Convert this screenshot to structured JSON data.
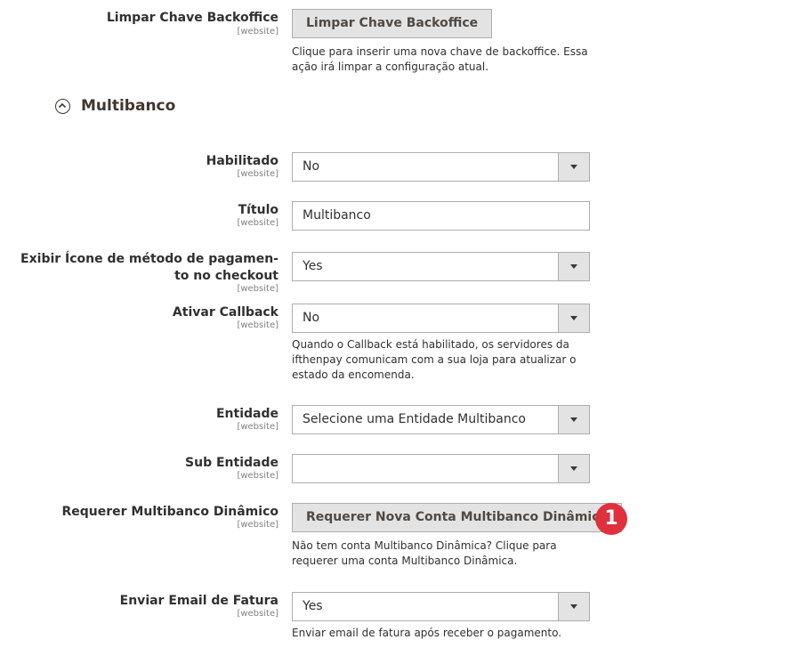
{
  "fields": {
    "limpar": {
      "label": "Limpar Chave Backoffice",
      "scope": "[website]",
      "button": "Limpar Chave Backoffice",
      "note": "Clique para inserir uma nova chave de backoffice. Essa ação irá limpar a configuração atual."
    },
    "section": {
      "title": "Multibanco"
    },
    "habilitado": {
      "label": "Habilitado",
      "scope": "[website]",
      "value": "No"
    },
    "titulo": {
      "label": "Título",
      "scope": "[website]",
      "value": "Multibanco"
    },
    "exibir_icone": {
      "label_line1": "Exibir Ícone de método de pagamen-",
      "label_line2": "to no checkout",
      "scope": "[website]",
      "value": "Yes"
    },
    "callback": {
      "label": "Ativar Callback",
      "scope": "[website]",
      "value": "No",
      "note": "Quando o Callback está habilitado, os servidores da ifthenpay comunicam com a sua loja para atualizar o estado da encomenda."
    },
    "entidade": {
      "label": "Entidade",
      "scope": "[website]",
      "value": "Selecione uma Entidade Multibanco"
    },
    "sub_entidade": {
      "label": "Sub Entidade",
      "scope": "[website]",
      "value": ""
    },
    "requerer": {
      "label": "Requerer Multibanco Dinâmico",
      "scope": "[website]",
      "button": "Requerer Nova Conta Multibanco Dinâmica",
      "note": "Não tem conta Multibanco Dinâmica? Clique para requerer uma conta Multibanco Dinâmica.",
      "badge": "1"
    },
    "email_fatura": {
      "label": "Enviar Email de Fatura",
      "scope": "[website]",
      "value": "Yes",
      "note": "Enviar email de fatura após receber o pagamento."
    }
  }
}
